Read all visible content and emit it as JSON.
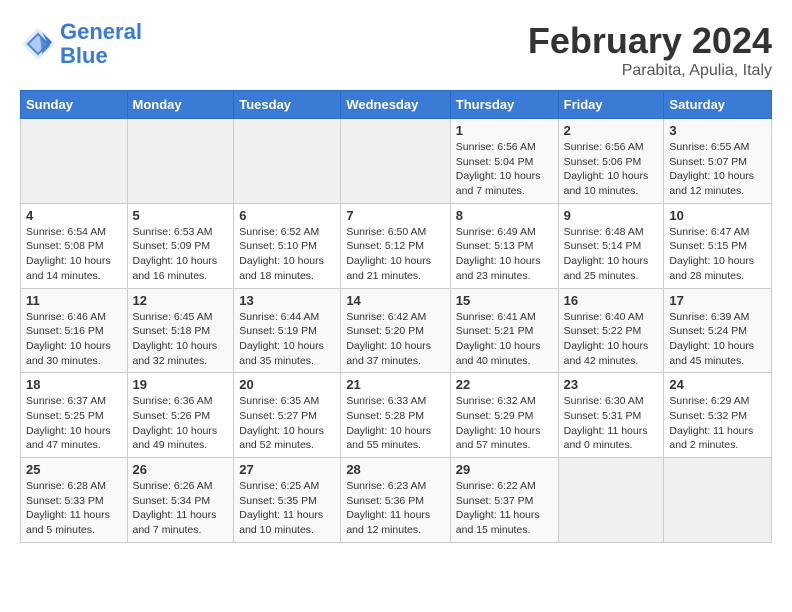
{
  "header": {
    "logo_line1": "General",
    "logo_line2": "Blue",
    "month": "February 2024",
    "location": "Parabita, Apulia, Italy"
  },
  "weekdays": [
    "Sunday",
    "Monday",
    "Tuesday",
    "Wednesday",
    "Thursday",
    "Friday",
    "Saturday"
  ],
  "weeks": [
    [
      {
        "day": "",
        "info": ""
      },
      {
        "day": "",
        "info": ""
      },
      {
        "day": "",
        "info": ""
      },
      {
        "day": "",
        "info": ""
      },
      {
        "day": "1",
        "info": "Sunrise: 6:56 AM\nSunset: 5:04 PM\nDaylight: 10 hours and 7 minutes."
      },
      {
        "day": "2",
        "info": "Sunrise: 6:56 AM\nSunset: 5:06 PM\nDaylight: 10 hours and 10 minutes."
      },
      {
        "day": "3",
        "info": "Sunrise: 6:55 AM\nSunset: 5:07 PM\nDaylight: 10 hours and 12 minutes."
      }
    ],
    [
      {
        "day": "4",
        "info": "Sunrise: 6:54 AM\nSunset: 5:08 PM\nDaylight: 10 hours and 14 minutes."
      },
      {
        "day": "5",
        "info": "Sunrise: 6:53 AM\nSunset: 5:09 PM\nDaylight: 10 hours and 16 minutes."
      },
      {
        "day": "6",
        "info": "Sunrise: 6:52 AM\nSunset: 5:10 PM\nDaylight: 10 hours and 18 minutes."
      },
      {
        "day": "7",
        "info": "Sunrise: 6:50 AM\nSunset: 5:12 PM\nDaylight: 10 hours and 21 minutes."
      },
      {
        "day": "8",
        "info": "Sunrise: 6:49 AM\nSunset: 5:13 PM\nDaylight: 10 hours and 23 minutes."
      },
      {
        "day": "9",
        "info": "Sunrise: 6:48 AM\nSunset: 5:14 PM\nDaylight: 10 hours and 25 minutes."
      },
      {
        "day": "10",
        "info": "Sunrise: 6:47 AM\nSunset: 5:15 PM\nDaylight: 10 hours and 28 minutes."
      }
    ],
    [
      {
        "day": "11",
        "info": "Sunrise: 6:46 AM\nSunset: 5:16 PM\nDaylight: 10 hours and 30 minutes."
      },
      {
        "day": "12",
        "info": "Sunrise: 6:45 AM\nSunset: 5:18 PM\nDaylight: 10 hours and 32 minutes."
      },
      {
        "day": "13",
        "info": "Sunrise: 6:44 AM\nSunset: 5:19 PM\nDaylight: 10 hours and 35 minutes."
      },
      {
        "day": "14",
        "info": "Sunrise: 6:42 AM\nSunset: 5:20 PM\nDaylight: 10 hours and 37 minutes."
      },
      {
        "day": "15",
        "info": "Sunrise: 6:41 AM\nSunset: 5:21 PM\nDaylight: 10 hours and 40 minutes."
      },
      {
        "day": "16",
        "info": "Sunrise: 6:40 AM\nSunset: 5:22 PM\nDaylight: 10 hours and 42 minutes."
      },
      {
        "day": "17",
        "info": "Sunrise: 6:39 AM\nSunset: 5:24 PM\nDaylight: 10 hours and 45 minutes."
      }
    ],
    [
      {
        "day": "18",
        "info": "Sunrise: 6:37 AM\nSunset: 5:25 PM\nDaylight: 10 hours and 47 minutes."
      },
      {
        "day": "19",
        "info": "Sunrise: 6:36 AM\nSunset: 5:26 PM\nDaylight: 10 hours and 49 minutes."
      },
      {
        "day": "20",
        "info": "Sunrise: 6:35 AM\nSunset: 5:27 PM\nDaylight: 10 hours and 52 minutes."
      },
      {
        "day": "21",
        "info": "Sunrise: 6:33 AM\nSunset: 5:28 PM\nDaylight: 10 hours and 55 minutes."
      },
      {
        "day": "22",
        "info": "Sunrise: 6:32 AM\nSunset: 5:29 PM\nDaylight: 10 hours and 57 minutes."
      },
      {
        "day": "23",
        "info": "Sunrise: 6:30 AM\nSunset: 5:31 PM\nDaylight: 11 hours and 0 minutes."
      },
      {
        "day": "24",
        "info": "Sunrise: 6:29 AM\nSunset: 5:32 PM\nDaylight: 11 hours and 2 minutes."
      }
    ],
    [
      {
        "day": "25",
        "info": "Sunrise: 6:28 AM\nSunset: 5:33 PM\nDaylight: 11 hours and 5 minutes."
      },
      {
        "day": "26",
        "info": "Sunrise: 6:26 AM\nSunset: 5:34 PM\nDaylight: 11 hours and 7 minutes."
      },
      {
        "day": "27",
        "info": "Sunrise: 6:25 AM\nSunset: 5:35 PM\nDaylight: 11 hours and 10 minutes."
      },
      {
        "day": "28",
        "info": "Sunrise: 6:23 AM\nSunset: 5:36 PM\nDaylight: 11 hours and 12 minutes."
      },
      {
        "day": "29",
        "info": "Sunrise: 6:22 AM\nSunset: 5:37 PM\nDaylight: 11 hours and 15 minutes."
      },
      {
        "day": "",
        "info": ""
      },
      {
        "day": "",
        "info": ""
      }
    ]
  ]
}
